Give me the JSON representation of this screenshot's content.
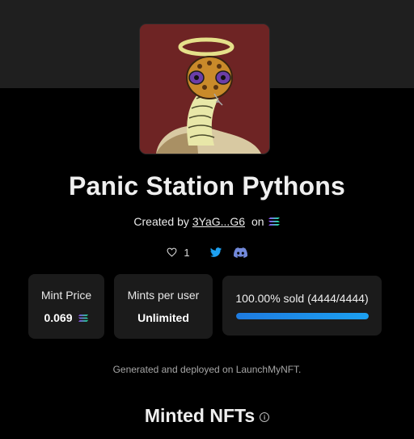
{
  "collection": {
    "title": "Panic Station Pythons",
    "created_by_label": "Created by",
    "creator_address": "3YaG...G6",
    "on_label": "on",
    "chain_icon": "solana-icon",
    "likes": "1",
    "social_icons": [
      "heart-icon",
      "twitter-icon",
      "discord-icon"
    ]
  },
  "stats": {
    "mint_price_label": "Mint Price",
    "mint_price_value": "0.069",
    "mints_per_user_label": "Mints per user",
    "mints_per_user_value": "Unlimited",
    "sold_text": "100.00% sold (4444/4444)",
    "sold_fraction": 1.0
  },
  "footer": {
    "note": "Generated and deployed on LaunchMyNFT.",
    "minted_heading": "Minted NFTs",
    "info_icon": "info-icon"
  },
  "colors": {
    "accent_blue": "#1ca0f0",
    "discord": "#7289da",
    "twitter": "#1da1f2"
  }
}
